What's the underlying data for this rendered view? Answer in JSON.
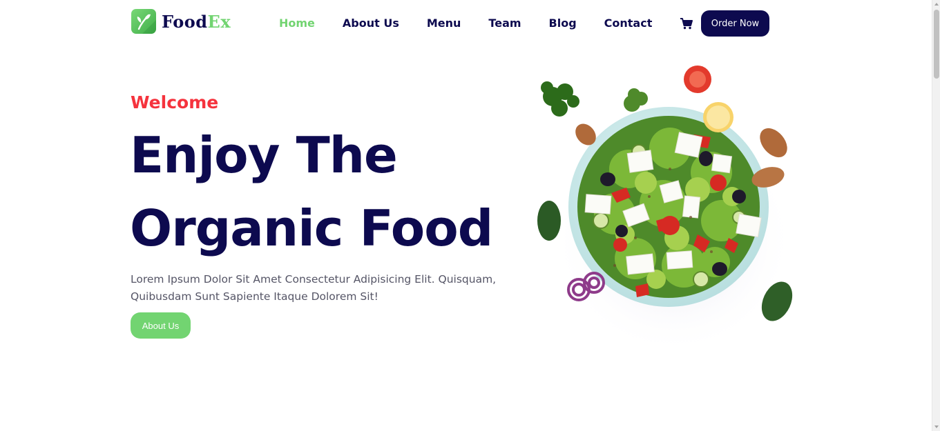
{
  "brand": {
    "name_part1": "Food",
    "name_part2": "Ex",
    "accent_color": "#72d471",
    "dark_color": "#0d0a4f",
    "highlight_color": "#f5333d"
  },
  "nav": {
    "items": [
      {
        "label": "Home",
        "active": true
      },
      {
        "label": "About Us",
        "active": false
      },
      {
        "label": "Menu",
        "active": false
      },
      {
        "label": "Team",
        "active": false
      },
      {
        "label": "Blog",
        "active": false
      },
      {
        "label": "Contact",
        "active": false
      }
    ],
    "cart_icon": "shopping-cart-icon",
    "order_button": "Order Now"
  },
  "hero": {
    "eyebrow": "Welcome",
    "title_line1": "Enjoy The",
    "title_line2": "Organic Food",
    "description": "Lorem Ipsum Dolor Sit Amet Consectetur Adipisicing Elit. Quisquam, Quibusdam Sunt Sapiente Itaque Dolorem Sit!",
    "button_label": "About Us"
  }
}
